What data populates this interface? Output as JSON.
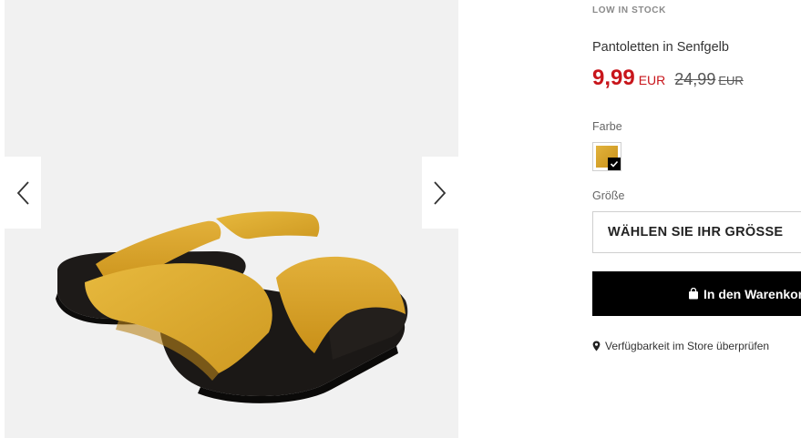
{
  "product": {
    "stock_status": "LOW IN STOCK",
    "name": "Pantoletten in Senfgelb",
    "price_now": "9,99",
    "currency_now": "EUR",
    "price_old": "24,99",
    "currency_old": "EUR"
  },
  "color": {
    "label": "Farbe",
    "selected_swatch": "mustard",
    "swatch_color": "#d9a62b"
  },
  "size": {
    "label": "Größe",
    "select_text": "WÄHLEN SIE IHR GRÖSSE"
  },
  "cart": {
    "label": "In den Warenkorb",
    "icon": "shopping-bag-icon"
  },
  "store": {
    "link_text": "Verfügbarkeit im Store überprüfen",
    "icon": "map-pin-icon"
  },
  "gallery": {
    "prev_icon": "chevron-left-icon",
    "next_icon": "chevron-right-icon"
  },
  "colors": {
    "price_red": "#c8151b",
    "button_black": "#000000",
    "photo_bg": "#f1f1f1"
  }
}
